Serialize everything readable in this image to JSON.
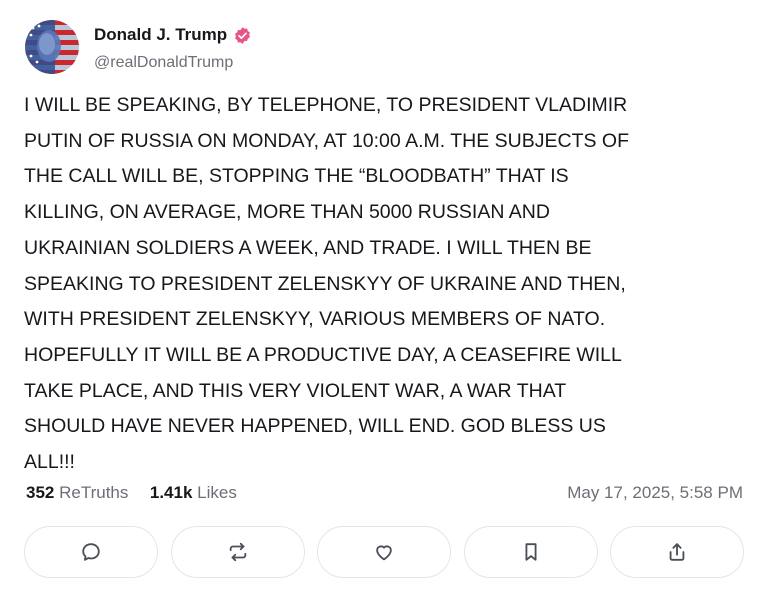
{
  "post": {
    "display_name": "Donald J. Trump",
    "handle": "@realDonaldTrump",
    "text": "I WILL BE SPEAKING, BY TELEPHONE, TO PRESIDENT VLADIMIR\nPUTIN OF RUSSIA ON MONDAY, AT 10:00 A.M. THE SUBJECTS OF\nTHE CALL WILL BE, STOPPING THE “BLOODBATH” THAT IS\nKILLING, ON AVERAGE, MORE THAN 5000 RUSSIAN AND\nUKRAINIAN SOLDIERS A WEEK, AND TRADE. I WILL THEN BE\nSPEAKING TO PRESIDENT ZELENSKYY OF UKRAINE AND THEN,\nWITH PRESIDENT ZELENSKYY, VARIOUS MEMBERS OF NATO.\nHOPEFULLY IT WILL BE A PRODUCTIVE DAY, A CEASEFIRE WILL\nTAKE PLACE, AND THIS VERY VIOLENT WAR, A WAR THAT\nSHOULD HAVE NEVER HAPPENED, WILL END. GOD BLESS US\nALL!!!",
    "retruths_count": "352",
    "retruths_label": "ReTruths",
    "likes_count": "1.41k",
    "likes_label": "Likes",
    "timestamp": "May 17, 2025, 5:58 PM"
  },
  "icons": {
    "avatar": "profile-photo",
    "verified": "verified-badge-icon",
    "reply": "comment-bubble-icon",
    "retruth": "retruth-arrows-icon",
    "like": "heart-icon",
    "bookmark": "bookmark-icon",
    "share": "share-upload-icon"
  },
  "colors": {
    "verified_badge": "#e8548a",
    "text_primary": "#16181c",
    "text_secondary": "#6b6f76",
    "button_border": "#e3e5e8",
    "icon": "#4a4f57"
  }
}
